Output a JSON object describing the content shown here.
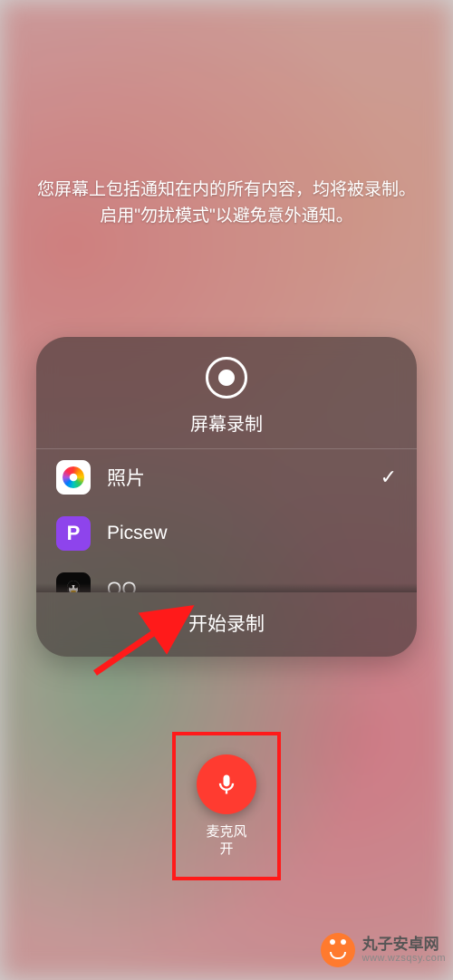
{
  "hint_text": "您屏幕上包括通知在内的所有内容，均将被录制。启用\"勿扰模式\"以避免意外通知。",
  "panel": {
    "title": "屏幕录制",
    "start_label": "开始录制",
    "apps": [
      {
        "name": "照片",
        "icon": "photos",
        "selected": true
      },
      {
        "name": "Picsew",
        "icon": "picsew",
        "selected": false
      },
      {
        "name": "QQ",
        "icon": "qq",
        "selected": false
      }
    ]
  },
  "mic": {
    "label": "麦克风\n开",
    "state": "on",
    "color": "#ff3b30"
  },
  "annotation": {
    "arrow_color": "#ff1a1a",
    "highlight_box_color": "#ff1a1a"
  },
  "watermark": {
    "brand": "丸子安卓网",
    "url": "www.wzsqsy.com"
  }
}
